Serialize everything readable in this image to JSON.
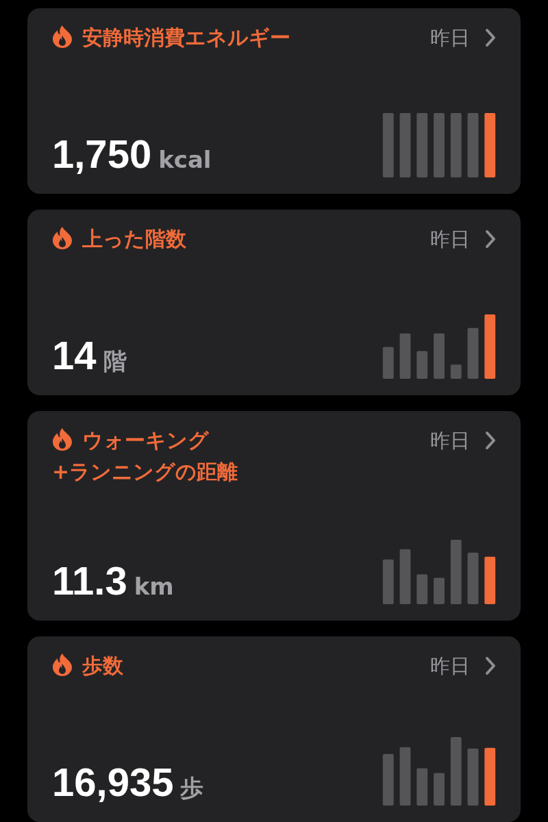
{
  "cards": [
    {
      "title": "安静時消費エネルギー",
      "period": "昨日",
      "value": "1,750",
      "unit": "kcal"
    },
    {
      "title": "上った階数",
      "period": "昨日",
      "value": "14",
      "unit": "階"
    },
    {
      "title": "ウォーキング\n+ランニングの距離",
      "period": "昨日",
      "value": "11.3",
      "unit": "km"
    },
    {
      "title": "歩数",
      "period": "昨日",
      "value": "16,935",
      "unit": "歩"
    }
  ]
}
